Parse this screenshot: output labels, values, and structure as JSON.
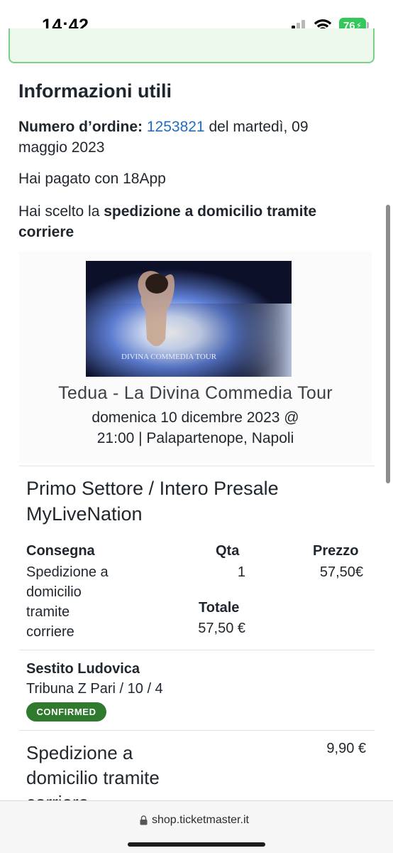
{
  "status_bar": {
    "time": "14:42",
    "battery": "76",
    "icons": [
      "signal-icon",
      "wifi-icon",
      "battery-icon"
    ]
  },
  "info": {
    "title": "Informazioni utili",
    "order_label": "Numero d’ordine:",
    "order_number": "1253821",
    "order_date_prefix": " del martedì, 09",
    "order_date_rest": "maggio 2023",
    "paid_text": "Hai pagato con 18App",
    "ship_prefix": "Hai scelto la ",
    "ship_bold_1": "spedizione a domicilio tramite",
    "ship_bold_2": "corriere"
  },
  "event": {
    "image_text": "DIVINA COMMEDIA TOUR",
    "title": "Tedua - La Divina Commedia Tour",
    "date_line1": "domenica 10 dicembre 2023 @",
    "date_line2": "21:00 | Palapartenope, Napoli"
  },
  "ticket": {
    "sector_line1": "Primo Settore / Intero Presale",
    "sector_line2": "MyLiveNation",
    "headers": {
      "delivery": "Consegna",
      "qty": "Qta",
      "price": "Prezzo",
      "total": "Totale"
    },
    "delivery_lines": [
      "Spedizione a",
      "domicilio",
      "tramite",
      "corriere"
    ],
    "qty": "1",
    "price": "57,50€",
    "total": "57,50 €",
    "holder": "Sestito Ludovica",
    "seat": "Tribuna Z Pari / 10 / 4",
    "status": "CONFIRMED"
  },
  "shipping": {
    "line1": "Spedizione a",
    "line2": "domicilio tramite",
    "line3": "corriere",
    "price": "9,90 €"
  },
  "browser": {
    "url": "shop.ticketmaster.it"
  },
  "colors": {
    "accent_link": "#1f6ec4",
    "confirmed_badge": "#2f7a2e",
    "banner_border": "#7bd08a",
    "battery": "#34c759"
  }
}
